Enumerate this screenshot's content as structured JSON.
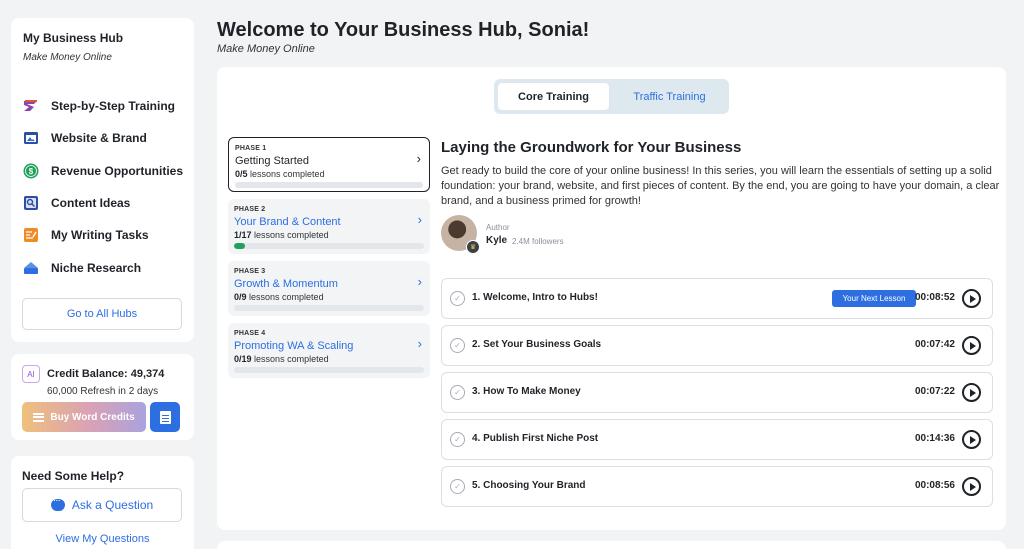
{
  "sidebar": {
    "title": "My Business Hub",
    "subtitle": "Make Money Online",
    "nav": [
      {
        "label": "Step-by-Step Training",
        "icon": "steps-icon",
        "color": "#8e44ad"
      },
      {
        "label": "Website & Brand",
        "icon": "website-icon",
        "color": "#2d4fa3"
      },
      {
        "label": "Revenue Opportunities",
        "icon": "dollar-icon",
        "color": "#1fa05b"
      },
      {
        "label": "Content Ideas",
        "icon": "content-icon",
        "color": "#2d4fa3"
      },
      {
        "label": "My Writing Tasks",
        "icon": "writing-icon",
        "color": "#f08a24"
      },
      {
        "label": "Niche Research",
        "icon": "research-icon",
        "color": "#2d6ee0"
      }
    ],
    "go_all_label": "Go to All Hubs"
  },
  "credits": {
    "badge": "AI",
    "title": "Credit Balance: 49,374",
    "refresh": "60,000 Refresh in 2 days",
    "buy_label": "Buy Word Credits"
  },
  "help": {
    "title": "Need Some Help?",
    "ask_label": "Ask a Question",
    "view_label": "View My Questions"
  },
  "main": {
    "title": "Welcome to Your Business Hub, Sonia!",
    "subtitle": "Make Money Online",
    "tabs": {
      "core": "Core Training",
      "traffic": "Traffic Training"
    },
    "phases": [
      {
        "label": "PHASE 1",
        "name": "Getting Started",
        "done": "0/5",
        "suffix": "lessons completed",
        "chevron": "›",
        "progress": 0
      },
      {
        "label": "PHASE 2",
        "name": "Your Brand & Content",
        "done": "1/17",
        "suffix": "lessons completed",
        "chevron": "›",
        "progress": 0.06
      },
      {
        "label": "PHASE 3",
        "name": "Growth & Momentum",
        "done": "0/9",
        "suffix": "lessons completed",
        "chevron": "›",
        "progress": 0
      },
      {
        "label": "PHASE 4",
        "name": "Promoting WA & Scaling",
        "done": "0/19",
        "suffix": "lessons completed",
        "chevron": "›",
        "progress": 0
      }
    ],
    "section_title": "Laying the Groundwork for Your Business",
    "section_desc": "Get ready to build the core of your online business! In this series, you will learn the essentials of setting up a solid foundation: your brand, website, and first pieces of content. By the end, you are going to have your domain, a clear brand, and a business primed for growth!",
    "author": {
      "label": "Author",
      "name": "Kyle",
      "followers": "2.4M followers"
    },
    "next_badge": "Your Next Lesson",
    "lessons": [
      {
        "title": "1. Welcome, Intro to Hubs!",
        "duration": "00:08:52",
        "check": "✓"
      },
      {
        "title": "2. Set Your Business Goals",
        "duration": "00:07:42",
        "check": "✓"
      },
      {
        "title": "3. How To Make Money",
        "duration": "00:07:22",
        "check": "✓"
      },
      {
        "title": "4. Publish First Niche Post",
        "duration": "00:14:36",
        "check": "✓"
      },
      {
        "title": "5. Choosing Your Brand",
        "duration": "00:08:56",
        "check": "✓"
      }
    ]
  }
}
